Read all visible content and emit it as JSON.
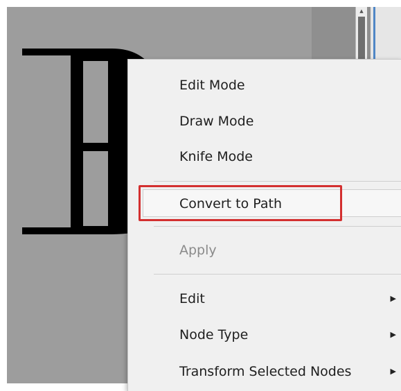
{
  "context_menu": {
    "items": [
      {
        "label": "Edit Mode",
        "enabled": true,
        "has_submenu": false
      },
      {
        "label": "Draw Mode",
        "enabled": true,
        "has_submenu": false
      },
      {
        "label": "Knife Mode",
        "enabled": true,
        "has_submenu": false
      },
      {
        "label": "Convert to Path",
        "enabled": true,
        "has_submenu": false,
        "highlighted": true,
        "annotated": true
      },
      {
        "label": "Apply",
        "enabled": false,
        "has_submenu": false
      },
      {
        "label": "Edit",
        "enabled": true,
        "has_submenu": true
      },
      {
        "label": "Node Type",
        "enabled": true,
        "has_submenu": true
      },
      {
        "label": "Transform Selected Nodes",
        "enabled": true,
        "has_submenu": true
      }
    ],
    "submenu_arrow": "▶"
  },
  "canvas": {
    "glyph_icon": "letter-b-shape-icon",
    "scroll_up_arrow": "▲"
  },
  "colors": {
    "canvas_background": "#9d9d9d",
    "glyph": "#000000",
    "menu_background": "#f0f0f0",
    "annotation": "#d32f2f",
    "disabled_text": "#8a8a8a"
  }
}
